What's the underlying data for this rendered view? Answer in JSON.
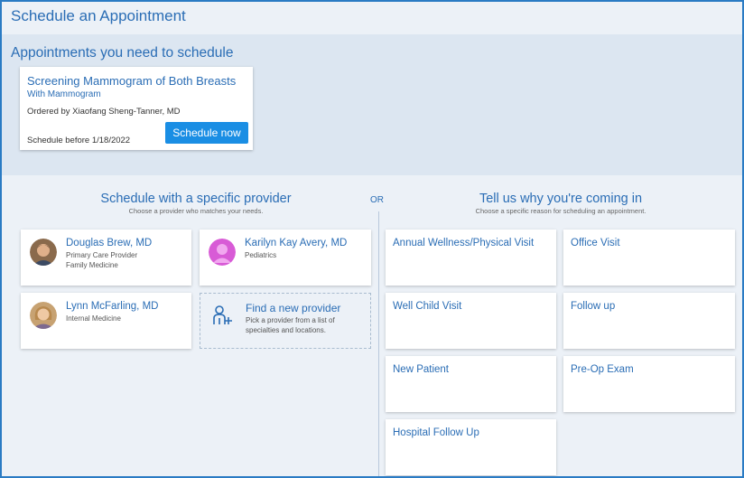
{
  "page": {
    "title": "Schedule an Appointment"
  },
  "needs": {
    "title": "Appointments you need to schedule",
    "appointment": {
      "name": "Screening Mammogram of Both Breasts",
      "sub": "With Mammogram",
      "ordered_by": "Ordered by Xiaofang Sheng-Tanner, MD",
      "schedule_before": "Schedule before 1/18/2022",
      "button_label": "Schedule now"
    }
  },
  "provider_section": {
    "title": "Schedule with a specific provider",
    "subtitle": "Choose a provider who matches your needs.",
    "providers": [
      {
        "name": "Douglas Brew, MD",
        "line1": "Primary Care Provider",
        "line2": "Family Medicine",
        "avatar": "male-photo-avatar"
      },
      {
        "name": "Karilyn Kay Avery, MD",
        "line1": "Pediatrics",
        "line2": "",
        "avatar": "generic-person-avatar"
      },
      {
        "name": "Lynn McFarling, MD",
        "line1": "Internal Medicine",
        "line2": "",
        "avatar": "female-photo-avatar"
      }
    ],
    "find_new": {
      "title": "Find a new provider",
      "line1": "Pick a provider from a list of",
      "line2": "specialties and locations.",
      "icon": "add-provider-icon"
    }
  },
  "or_label": "OR",
  "reason_section": {
    "title": "Tell us why you're coming in",
    "subtitle": "Choose a specific reason for scheduling an appointment.",
    "reasons": [
      "Annual Wellness/Physical Visit",
      "Office Visit",
      "Well Child Visit",
      "Follow up",
      "New Patient",
      "Pre-Op Exam",
      "Hospital Follow Up"
    ]
  },
  "colors": {
    "accent": "#2a6db5",
    "button": "#1a8ee4",
    "frame_border": "#2a7bc4",
    "band": "#dce6f1",
    "background": "#ecf1f7"
  }
}
